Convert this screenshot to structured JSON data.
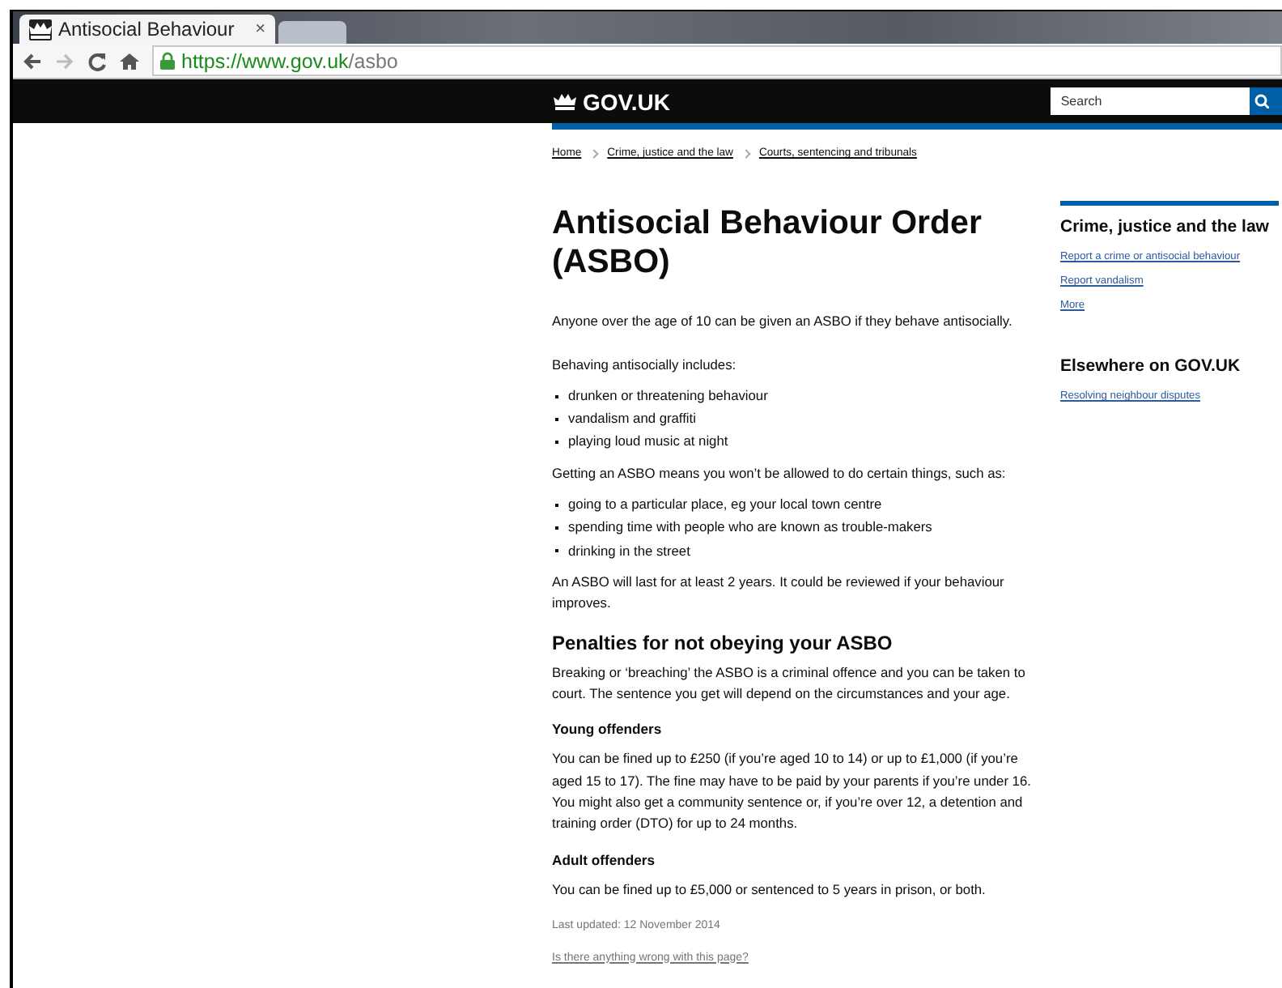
{
  "browser": {
    "tab_title": "Antisocial Behaviour",
    "tab_close": "×",
    "url_host": "https://www.gov.uk",
    "url_path": "/asbo"
  },
  "header": {
    "logo": "GOV.UK",
    "search": {
      "placeholder": "Search"
    }
  },
  "breadcrumbs": [
    "Home",
    "Crime, justice and the law",
    "Courts, sentencing and tribunals"
  ],
  "title": "Antisocial Behaviour Order (ASBO)",
  "content": [
    {
      "kind": "lead",
      "text": "Anyone over the age of 10 can be given an ASBO if they behave antisocially."
    },
    {
      "kind": "paragraph",
      "text": "Behaving antisocially includes:"
    },
    {
      "kind": "list",
      "items": [
        "drunken or threatening behaviour",
        "vandalism and graffiti",
        "playing loud music at night"
      ]
    },
    {
      "kind": "paragraph",
      "text": "Getting an ASBO means you won’t be allowed to do certain things, such as:"
    },
    {
      "kind": "list",
      "items": [
        "going to a particular place, eg your local town centre",
        "spending time with people who are known as trouble-makers",
        "drinking in the street"
      ]
    },
    {
      "kind": "paragraph",
      "text": "An ASBO will last for at least 2 years. It could be reviewed if your behaviour improves."
    },
    {
      "kind": "heading",
      "text": "Penalties for not obeying your ASBO"
    },
    {
      "kind": "paragraph",
      "text": "Breaking or ‘breaching’ the ASBO is a criminal offence and you can be taken to court. The sentence you get will depend on the circumstances and your age."
    },
    {
      "kind": "subheading",
      "text": "Young offenders"
    },
    {
      "kind": "paragraph",
      "text": "You can be fined up to £250 (if you’re aged 10 to 14) or up to £1,000 (if you’re aged 15 to 17). The fine may have to be paid by your parents if you’re under 16. You might also get a community sentence or, if you’re over 12, a detention and training order (DTO) for up to 24 months."
    },
    {
      "kind": "subheading",
      "text": "Adult offenders"
    },
    {
      "kind": "paragraph",
      "text": "You can be fined up to £5,000 or sentenced to 5 years in prison, or both."
    },
    {
      "kind": "meta",
      "text": "Last updated: 12 November 2014"
    },
    {
      "kind": "link",
      "text": "Is there anything wrong with this page?"
    }
  ],
  "sidebar": [
    {
      "heading": "Crime, justice and the law",
      "accent": true,
      "links": [
        "Report a crime or antisocial behaviour",
        "Report vandalism",
        "More"
      ]
    },
    {
      "heading": "Elsewhere on GOV.UK",
      "accent": false,
      "links": [
        "Resolving neighbour disputes"
      ]
    }
  ]
}
